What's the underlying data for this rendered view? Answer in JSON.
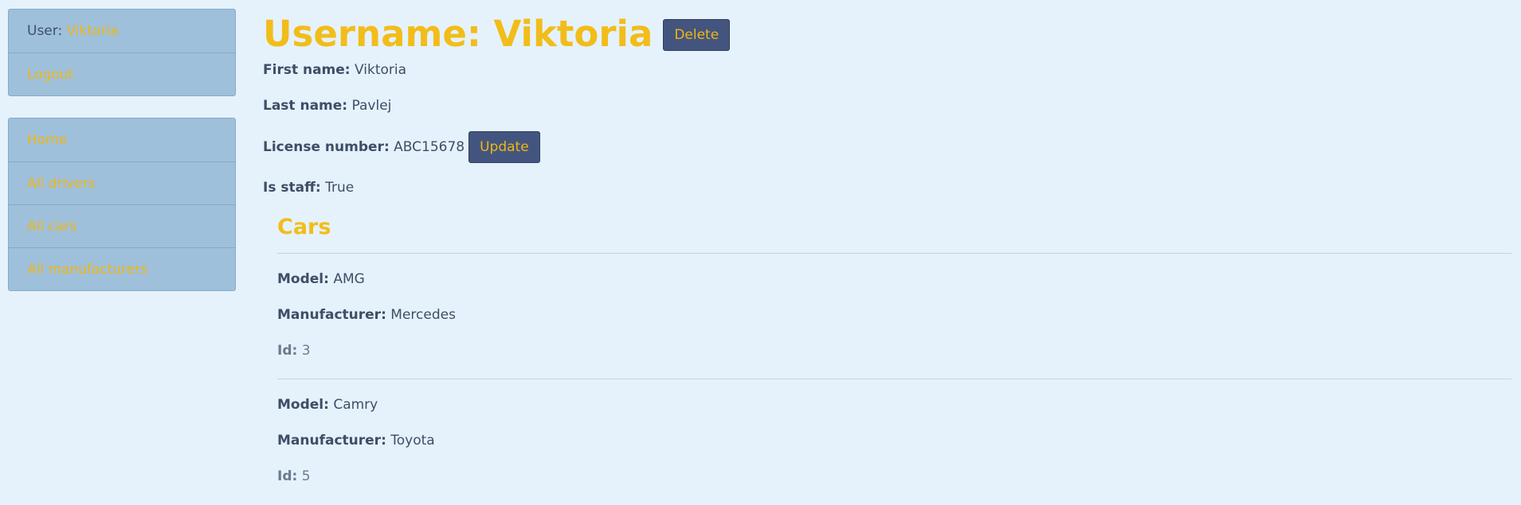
{
  "sidebar": {
    "user_label": "User:",
    "user_name": "Viktoria",
    "logout": "Logout",
    "nav": [
      "Home",
      "All drivers",
      "All cars",
      "All manufacturers"
    ]
  },
  "driver": {
    "title": "Username: Viktoria",
    "delete_label": "Delete",
    "update_label": "Update",
    "first_name_label": "First name:",
    "first_name": "Viktoria",
    "last_name_label": "Last name:",
    "last_name": "Pavlej",
    "license_label": "License number:",
    "license": "ABC15678",
    "staff_label": "Is staff:",
    "staff": "True"
  },
  "cars": {
    "title": "Cars",
    "model_label": "Model:",
    "manufacturer_label": "Manufacturer:",
    "id_label": "Id:",
    "items": [
      {
        "model": "AMG",
        "manufacturer": "Mercedes",
        "id": "3"
      },
      {
        "model": "Camry",
        "manufacturer": "Toyota",
        "id": "5"
      }
    ]
  },
  "colors": {
    "background": "#e5f2fc",
    "sidebar": "#9fc0db",
    "accent": "#f2bd1a",
    "button": "#43557f",
    "text": "#3f4d66"
  }
}
